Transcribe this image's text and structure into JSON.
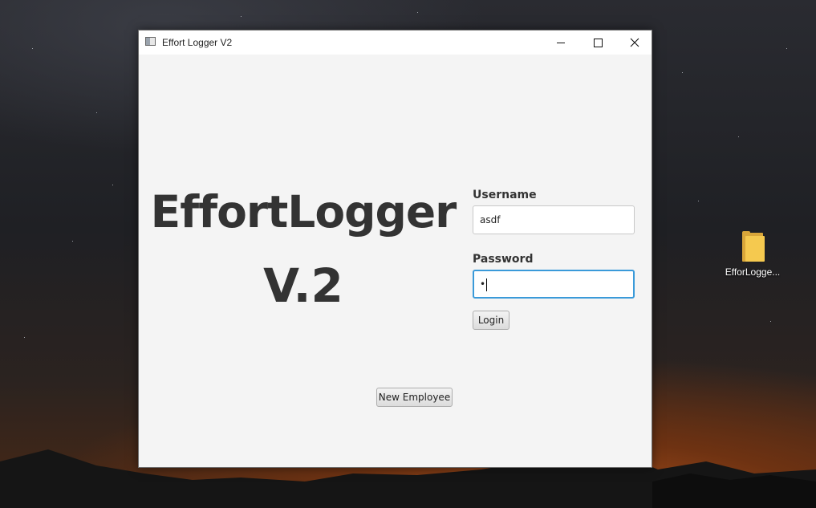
{
  "window": {
    "title": "Effort Logger V2",
    "minimize_icon": "minimize-icon",
    "maximize_icon": "maximize-icon",
    "close_icon": "close-icon"
  },
  "branding": {
    "line1": "EffortLogger",
    "line2": "V.2"
  },
  "login": {
    "username_label": "Username",
    "username_value": "asdf",
    "password_label": "Password",
    "password_value": "•",
    "login_button": "Login"
  },
  "new_employee_button": "New Employee",
  "desktop": {
    "icon_label": "EfforLogge..."
  },
  "colors": {
    "focus_border": "#3a9ad9",
    "brand_text": "#333333",
    "window_bg": "#f4f4f4"
  }
}
